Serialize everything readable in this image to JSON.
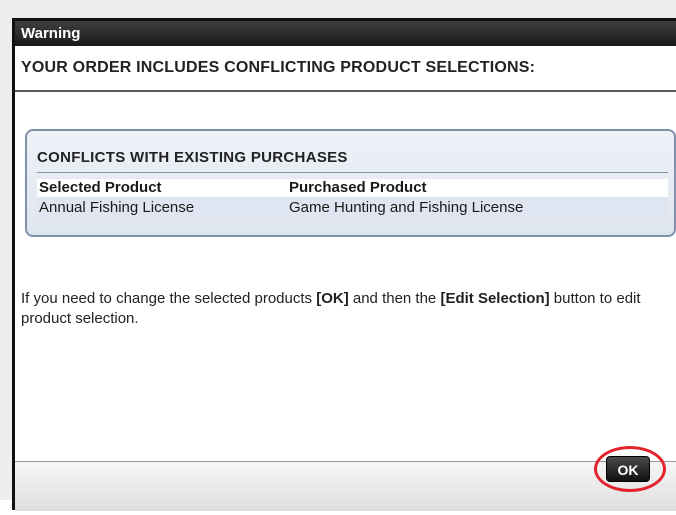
{
  "dialog": {
    "title": "Warning",
    "headline": "YOUR ORDER INCLUDES CONFLICTING PRODUCT SELECTIONS:"
  },
  "conflicts": {
    "title": "CONFLICTS WITH EXISTING PURCHASES",
    "columns": [
      "Selected Product",
      "Purchased Product"
    ],
    "rows": [
      [
        "Annual Fishing License",
        "Game Hunting and Fishing License"
      ]
    ]
  },
  "message": {
    "part1": "If you need to change the selected products ",
    "ok_ref": "[OK]",
    "part2": " and then the ",
    "edit_ref": "[Edit Selection]",
    "part3": " button to edit product selection."
  },
  "footer": {
    "ok_label": "OK"
  },
  "colors": {
    "highlight": "#e2232b",
    "panel_border": "#7e90aa",
    "titlebar": "#1a1a1a"
  }
}
